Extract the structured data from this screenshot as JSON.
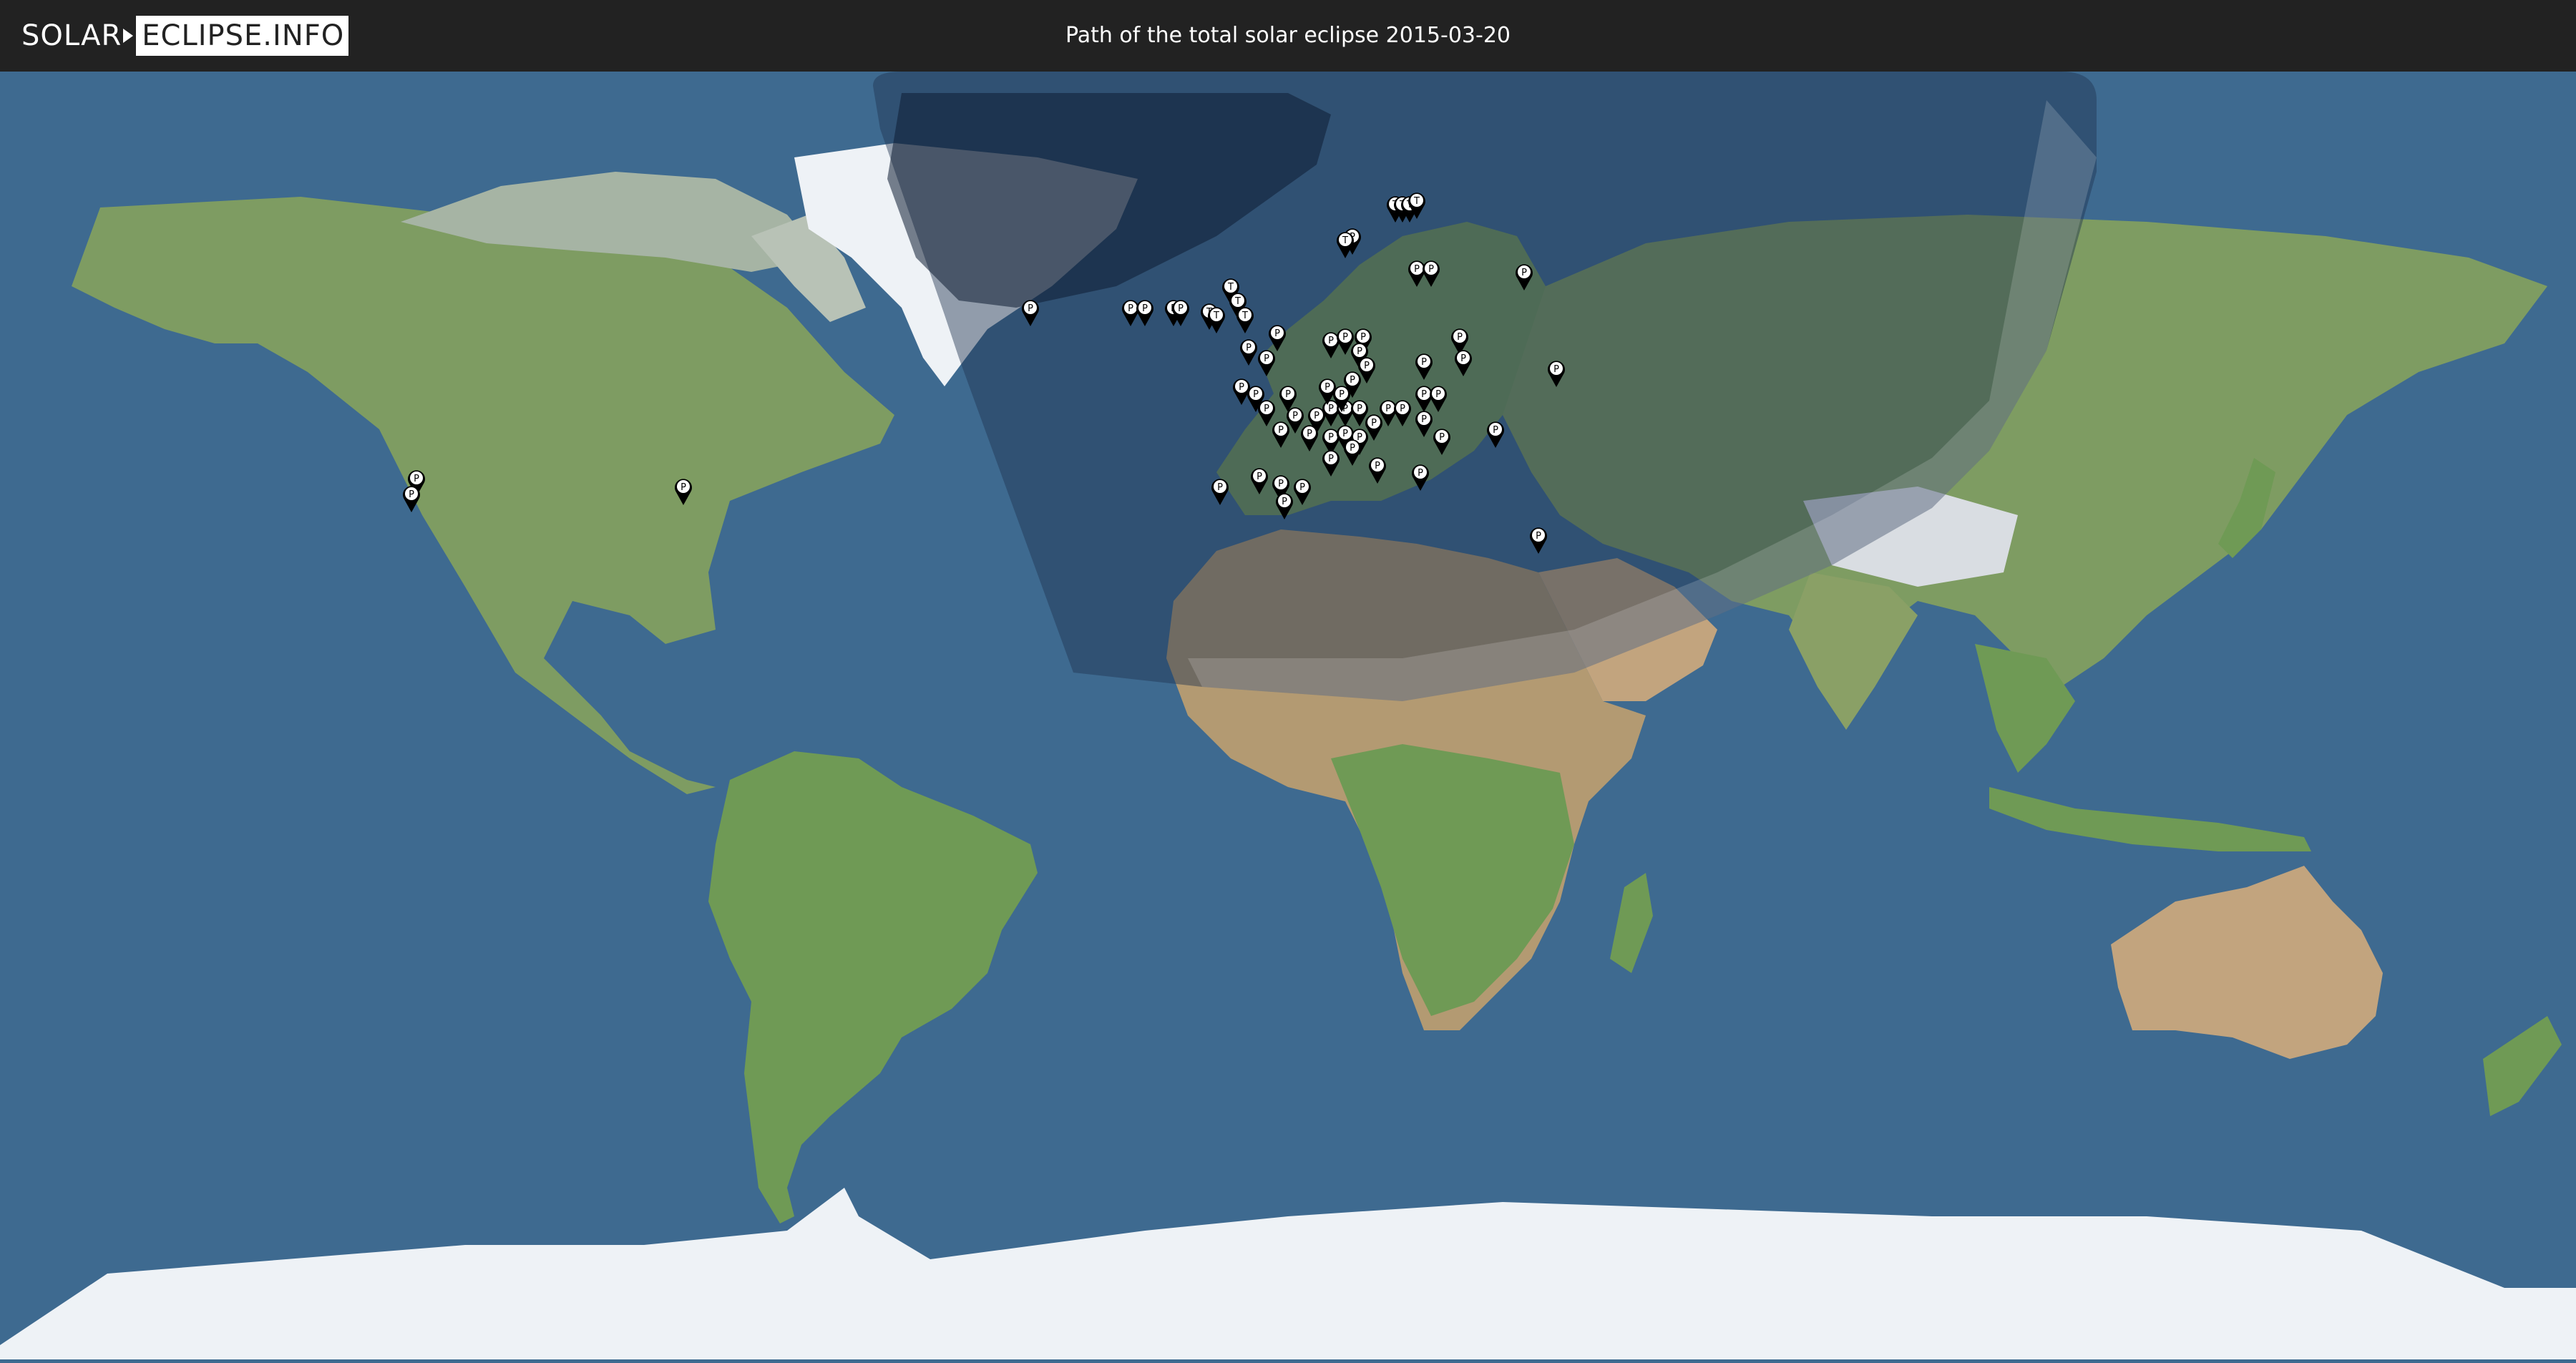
{
  "header": {
    "logo_left": "SOLAR",
    "logo_right": "ECLIPSE.INFO",
    "title": "Path of the total solar eclipse 2015-03-20"
  },
  "map": {
    "colors": {
      "ocean": "#3e6a90",
      "land": "#7a9a5e",
      "desert": "#b39a72",
      "ice": "#eef2f6",
      "partial_zone": "#2d4d6c",
      "totality_band": "#1f3550",
      "marker": "#000000",
      "marker_face": "#ffffff"
    },
    "marker_icons": [
      "partial-marker-icon",
      "total-marker-icon"
    ],
    "marker_labels": {
      "partial": "P",
      "total": "T"
    }
  }
}
